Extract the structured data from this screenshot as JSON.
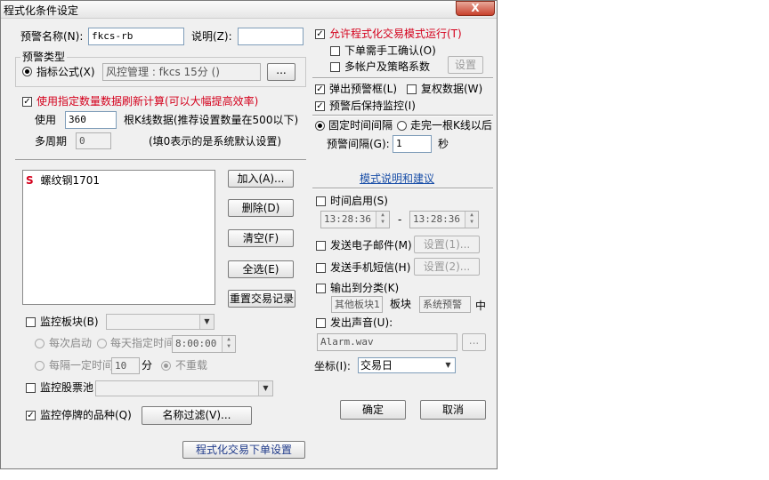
{
  "window": {
    "title": "程式化条件设定",
    "close_label": "X"
  },
  "alert_name": {
    "label": "预警名称(N):",
    "value": "fkcs-rb"
  },
  "description": {
    "label": "说明(Z):",
    "value": ""
  },
  "alert_type": {
    "group_label": "预警类型",
    "indicator_formula_label": "指标公式(X)",
    "formula_value": "风控管理 : fkcs 15分 ()",
    "browse_label": "..."
  },
  "use_count": {
    "label": "使用指定数量数据刷新计算(可以大幅提高效率)",
    "use_label": "使用",
    "value": "360",
    "suffix": "根K线数据(推荐设置数量在500以下)",
    "multi_period_label": "多周期",
    "multi_period_value": "0",
    "hint": "(填0表示的是系统默认设置)"
  },
  "list": {
    "items": [
      {
        "badge": "S",
        "name": "螺纹钢1701"
      }
    ]
  },
  "buttons": {
    "add": "加入(A)...",
    "delete": "删除(D)",
    "clear": "清空(F)",
    "select_all": "全选(E)",
    "reset_trades": "重置交易记录",
    "name_filter": "名称过滤(V)...",
    "program_order": "程式化交易下单设置",
    "ok": "确定",
    "cancel": "取消"
  },
  "monitor_sector": {
    "label": "监控板块(B)",
    "each_start": "每次启动",
    "daily_time": "每天指定时间",
    "daily_time_value": "8:00:00",
    "interval_label": "每隔一定时间",
    "interval_value": "10",
    "interval_unit": "分",
    "no_reload": "不重载"
  },
  "monitor_pool": {
    "label": "监控股票池"
  },
  "monitor_suspended": {
    "label": "监控停牌的品种(Q)"
  },
  "right": {
    "allow_mode": "允许程式化交易模式运行(T)",
    "manual_confirm": "下单需手工确认(O)",
    "multi_account": "多帐户及策略系数",
    "settings_label": "设置",
    "popup_alert": "弹出预警框(L)",
    "rights_data": "复权数据(W)",
    "keep_monitoring": "预警后保持监控(I)",
    "fixed_interval": "固定时间间隔",
    "after_kline": "走完一根K线以后",
    "alert_interval_label": "预警间隔(G):",
    "alert_interval_value": "1",
    "alert_interval_unit": "秒",
    "mode_help": "模式说明和建议",
    "time_enable": "时间启用(S)",
    "time_start": "13:28:36",
    "time_dash": "-",
    "time_end": "13:28:36",
    "send_email": "发送电子邮件(M)",
    "email_settings": "设置(1)...",
    "send_sms": "发送手机短信(H)",
    "sms_settings": "设置(2)...",
    "output_category": "输出到分类(K)",
    "category_value": "其他板块1",
    "sector_label": "板块",
    "sector_value": "系统预警",
    "middle_label": "中",
    "play_sound": "发出声音(U):",
    "sound_file": "Alarm.wav",
    "sound_browse": "...",
    "coord_label": "坐标(I):",
    "coord_value": "交易日"
  }
}
